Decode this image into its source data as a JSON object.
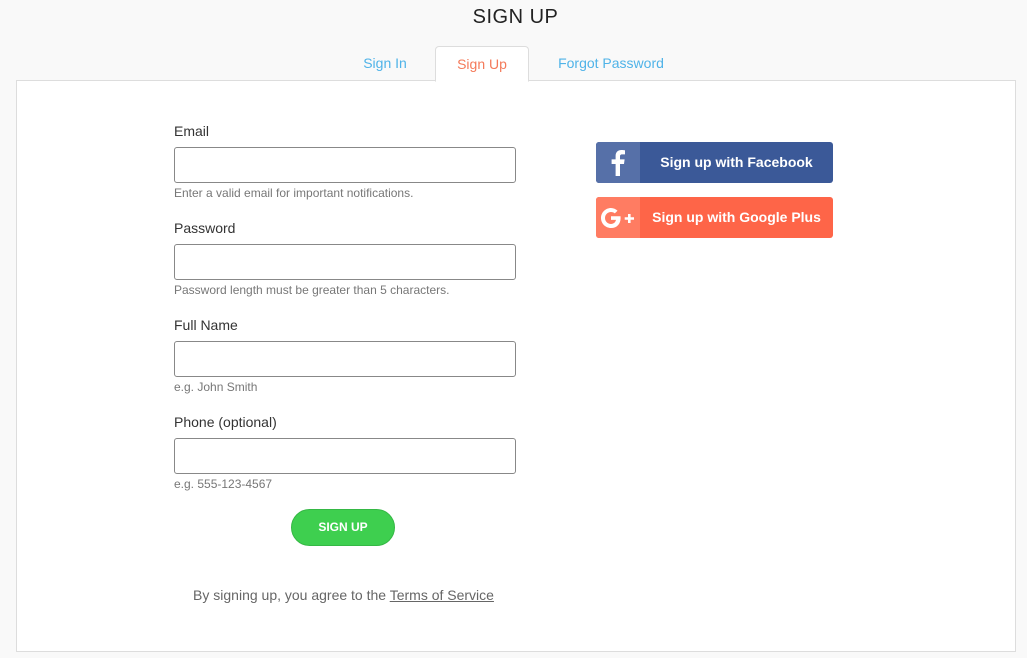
{
  "header": {
    "title": "SIGN UP"
  },
  "tabs": [
    {
      "label": "Sign In",
      "active": false
    },
    {
      "label": "Sign Up",
      "active": true
    },
    {
      "label": "Forgot Password",
      "active": false
    }
  ],
  "form": {
    "fields": [
      {
        "label": "Email",
        "value": "",
        "placeholder": "",
        "help": "Enter a valid email for important notifications."
      },
      {
        "label": "Password",
        "value": "",
        "placeholder": "",
        "help": "Password length must be greater than 5 characters."
      },
      {
        "label": "Full Name",
        "value": "",
        "placeholder": "",
        "help": "e.g. John Smith"
      },
      {
        "label": "Phone (optional)",
        "value": "",
        "placeholder": "",
        "help": "e.g. 555-123-4567"
      }
    ],
    "submit_label": "SIGN UP",
    "terms_prefix": "By signing up, you agree to the ",
    "terms_link": "Terms of Service"
  },
  "social": {
    "facebook": {
      "label": "Sign up with Facebook",
      "icon": "facebook-icon",
      "color": "#3b5998"
    },
    "google": {
      "label": "Sign up with Google Plus",
      "icon": "google-plus-icon",
      "color": "#fe6548"
    }
  },
  "colors": {
    "tab_link": "#4fb3e8",
    "tab_active": "#f47a5a",
    "submit": "#3ecf4f"
  }
}
